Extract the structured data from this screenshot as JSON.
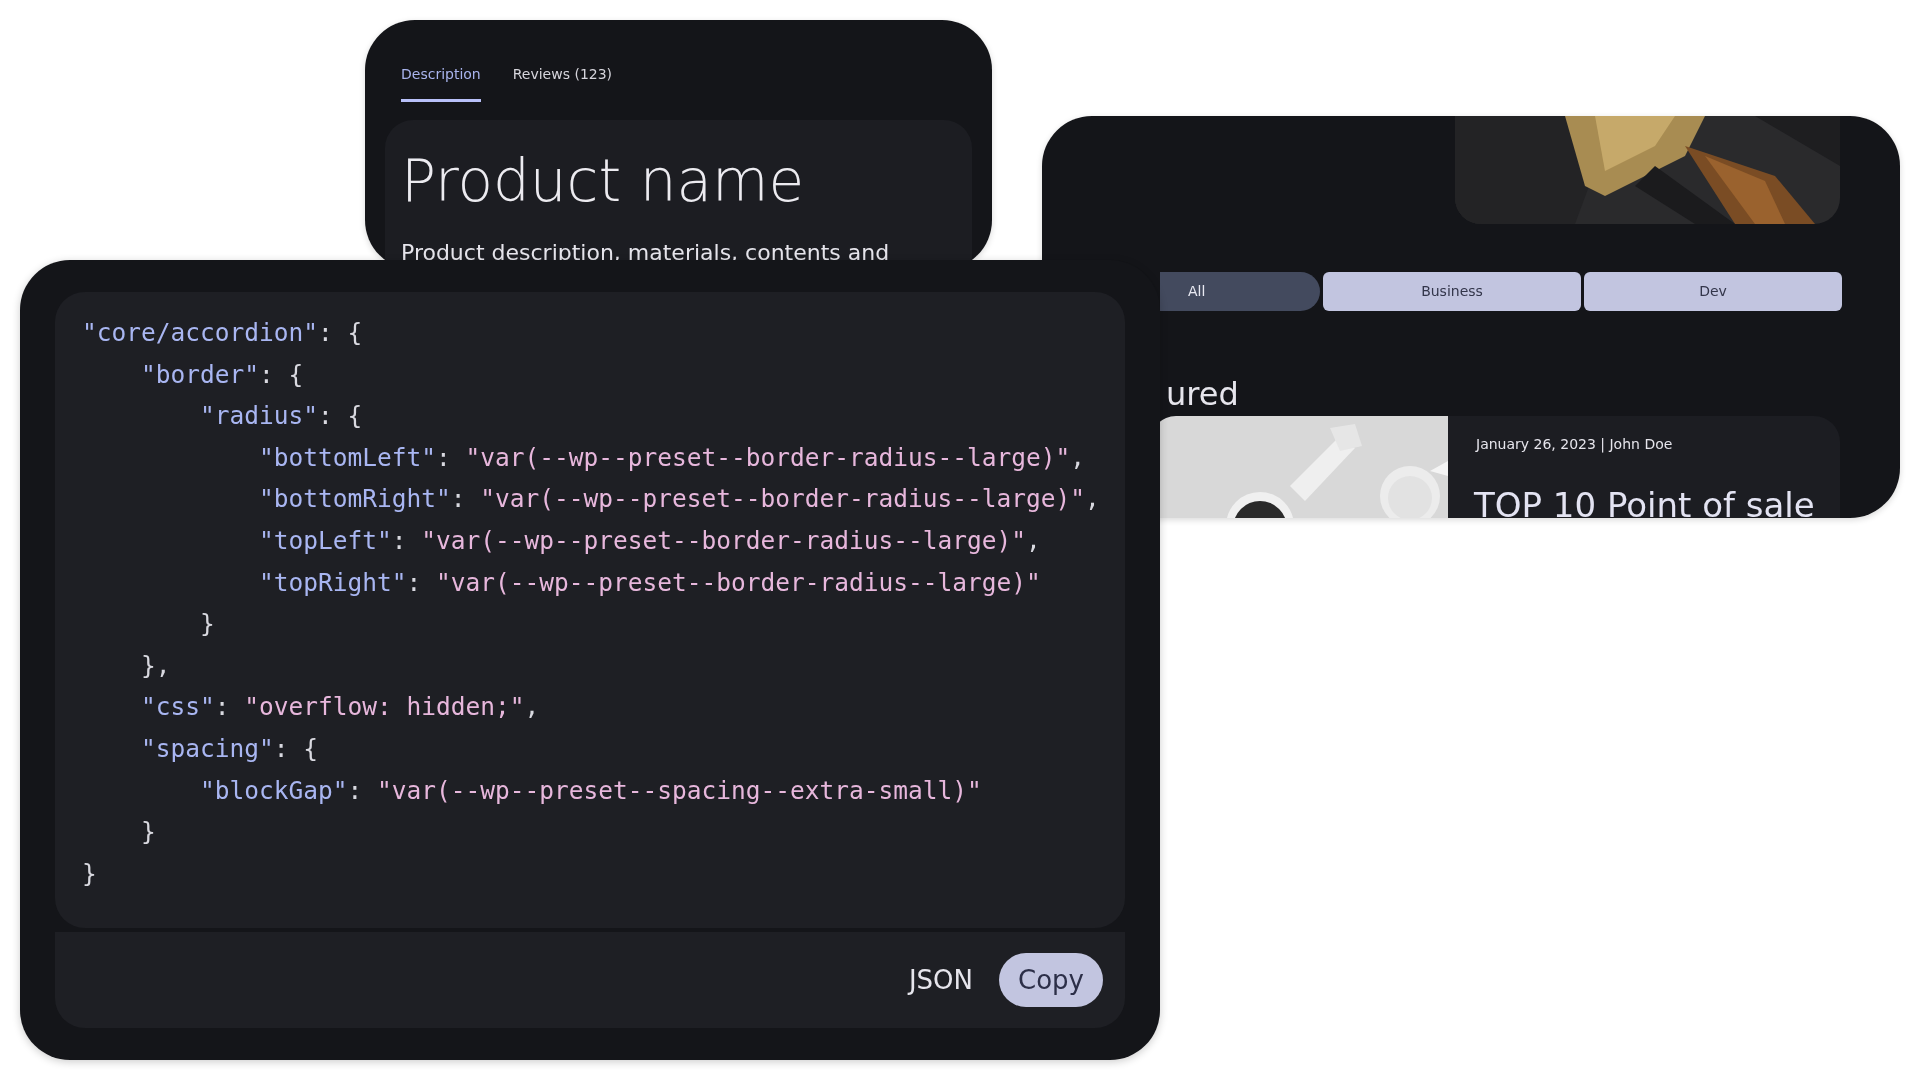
{
  "product_card": {
    "tabs": [
      {
        "label": "Description",
        "selected": true
      },
      {
        "label": "Reviews (123)",
        "selected": false
      }
    ],
    "title": "Product name",
    "description": "Product description, materials, contents and"
  },
  "blog_card": {
    "filters": [
      {
        "label": "All",
        "selected": true
      },
      {
        "label": "Business",
        "selected": false
      },
      {
        "label": "Dev",
        "selected": false
      }
    ],
    "section_heading": "ured",
    "post": {
      "meta": "January 26, 2023 | John Doe",
      "title": "TOP 10 Point of sale"
    }
  },
  "code_card": {
    "lines": [
      [
        {
          "kind": "key",
          "text": "\"core/accordion\""
        },
        {
          "kind": "punct",
          "text": ": {"
        }
      ],
      [
        {
          "kind": "key",
          "text": "    \"border\""
        },
        {
          "kind": "punct",
          "text": ": {"
        }
      ],
      [
        {
          "kind": "key",
          "text": "        \"radius\""
        },
        {
          "kind": "punct",
          "text": ": {"
        }
      ],
      [
        {
          "kind": "key",
          "text": "            \"bottomLeft\""
        },
        {
          "kind": "punct",
          "text": ": "
        },
        {
          "kind": "string",
          "text": "\"var(--wp--preset--border-radius--large)\""
        },
        {
          "kind": "punct",
          "text": ","
        }
      ],
      [
        {
          "kind": "key",
          "text": "            \"bottomRight\""
        },
        {
          "kind": "punct",
          "text": ": "
        },
        {
          "kind": "string",
          "text": "\"var(--wp--preset--border-radius--large)\""
        },
        {
          "kind": "punct",
          "text": ","
        }
      ],
      [
        {
          "kind": "key",
          "text": "            \"topLeft\""
        },
        {
          "kind": "punct",
          "text": ": "
        },
        {
          "kind": "string",
          "text": "\"var(--wp--preset--border-radius--large)\""
        },
        {
          "kind": "punct",
          "text": ","
        }
      ],
      [
        {
          "kind": "key",
          "text": "            \"topRight\""
        },
        {
          "kind": "punct",
          "text": ": "
        },
        {
          "kind": "string",
          "text": "\"var(--wp--preset--border-radius--large)\""
        }
      ],
      [
        {
          "kind": "punct",
          "text": "        }"
        }
      ],
      [
        {
          "kind": "punct",
          "text": "    },"
        }
      ],
      [
        {
          "kind": "key",
          "text": "    \"css\""
        },
        {
          "kind": "punct",
          "text": ": "
        },
        {
          "kind": "string",
          "text": "\"overflow: hidden;\""
        },
        {
          "kind": "punct",
          "text": ","
        }
      ],
      [
        {
          "kind": "key",
          "text": "    \"spacing\""
        },
        {
          "kind": "punct",
          "text": ": {"
        }
      ],
      [
        {
          "kind": "key",
          "text": "        \"blockGap\""
        },
        {
          "kind": "punct",
          "text": ": "
        },
        {
          "kind": "string",
          "text": "\"var(--wp--preset--spacing--extra-small)\""
        }
      ],
      [
        {
          "kind": "punct",
          "text": "    }"
        }
      ],
      [
        {
          "kind": "punct",
          "text": "}"
        }
      ]
    ],
    "language": "JSON",
    "copy_button": "Copy"
  }
}
